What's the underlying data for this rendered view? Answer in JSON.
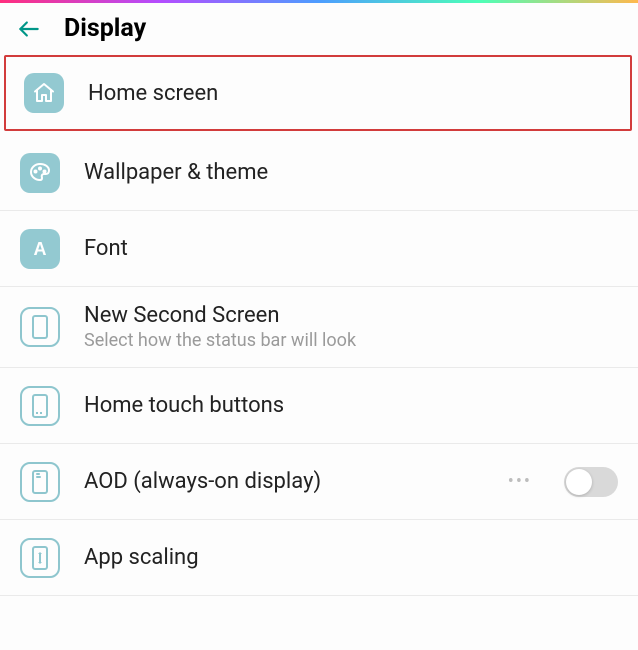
{
  "header": {
    "title": "Display"
  },
  "items": [
    {
      "icon": "home-icon",
      "label": "Home screen",
      "highlighted": true
    },
    {
      "icon": "palette-icon",
      "label": "Wallpaper & theme"
    },
    {
      "icon": "font-icon",
      "label": "Font"
    },
    {
      "icon": "second-screen-icon",
      "label": "New Second Screen",
      "sub": "Select how the status bar will look"
    },
    {
      "icon": "touch-buttons-icon",
      "label": "Home touch buttons"
    },
    {
      "icon": "aod-icon",
      "label": "AOD (always-on display)",
      "has_more": true,
      "has_toggle": true,
      "toggle_on": false
    },
    {
      "icon": "app-scaling-icon",
      "label": "App scaling"
    }
  ]
}
